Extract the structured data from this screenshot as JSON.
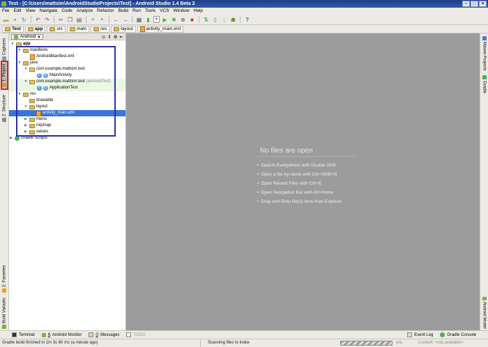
{
  "window": {
    "title": "Test - [C:\\Users\\mattsim\\AndroidStudioProjects\\Test] - Android Studio 1.4 Beta 2"
  },
  "menu": [
    "File",
    "Edit",
    "View",
    "Navigate",
    "Code",
    "Analyze",
    "Refactor",
    "Build",
    "Run",
    "Tools",
    "VCS",
    "Window",
    "Help"
  ],
  "toolbar": {
    "help": "?"
  },
  "breadcrumbs": [
    "Test",
    "app",
    "src",
    "main",
    "res",
    "layout",
    "activity_main.xml"
  ],
  "left_tabs": {
    "captures": "Captures",
    "project": "1: Project",
    "structure": "2: Structure",
    "favorites": "2: Favorites",
    "build_variants": "Build Variants"
  },
  "right_tabs": {
    "maven": "Maven Projects",
    "gradle": "Gradle",
    "android_model": "Android Model"
  },
  "project_panel": {
    "view": "Android"
  },
  "tree": {
    "app": "app",
    "manifests": "manifests",
    "manifest_file": "AndroidManifest.xml",
    "java": "java",
    "pkg1": "com.example.mattsim.test",
    "main_activity": "MainActivity",
    "pkg2": "com.example.mattsim.test",
    "pkg2_suffix": "(androidTest)",
    "app_test": "ApplicationTest",
    "res": "res",
    "drawable": "drawable",
    "layout": "layout",
    "activity_main": "activity_main.xml",
    "menu": "menu",
    "mipmap": "mipmap",
    "values": "values",
    "gradle_scripts": "Gradle Scripts"
  },
  "editor": {
    "empty_title": "No files are open",
    "hints": [
      "Search Everywhere with Double Shift",
      "Open a file by name with Ctrl+Shift+N",
      "Open Recent Files with Ctrl+E",
      "Open Navigation Bar with Alt+Home",
      "Drag and Drop file(s) here from Explorer"
    ]
  },
  "bottom_tabs": {
    "terminal": "Terminal",
    "monitor_num": "6",
    "monitor": ": Android Monitor",
    "messages_num": "0",
    "messages": ": Messages",
    "todo": "TODO",
    "event_log": "Event Log",
    "gradle_console": "Gradle Console"
  },
  "status": {
    "message": "Gradle build finished in 1m 3s 60 ms (a minute ago)",
    "scanning": "Scanning files to index",
    "na": "n/a",
    "context": "Context: <not available>"
  }
}
